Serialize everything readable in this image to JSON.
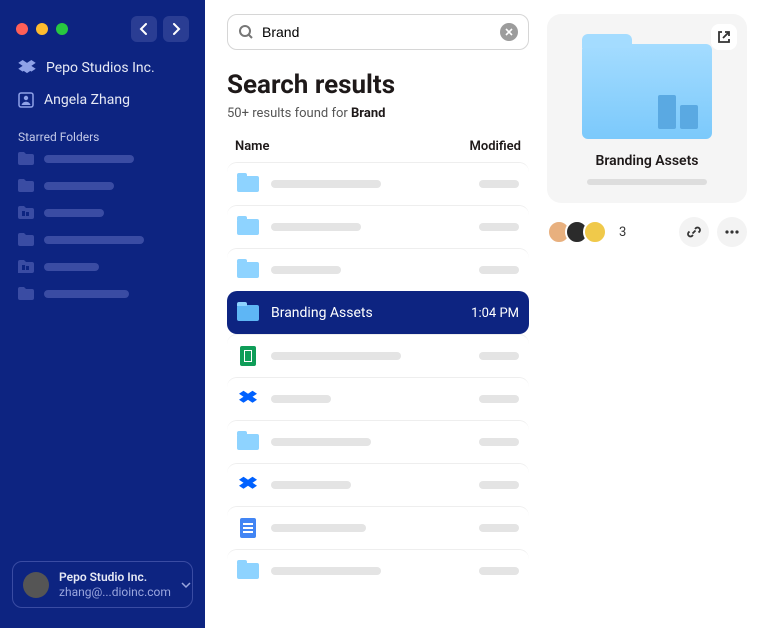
{
  "sidebar": {
    "org_name": "Pepo Studios Inc.",
    "user_name": "Angela Zhang",
    "section_title": "Starred Folders",
    "account": {
      "name": "Pepo Studio Inc.",
      "email": "zhang@...dioinc.com"
    }
  },
  "search": {
    "query": "Brand"
  },
  "results": {
    "title": "Search results",
    "count_prefix": "50+ results found for ",
    "count_term": "Brand",
    "col_name": "Name",
    "col_modified": "Modified",
    "selected": {
      "name": "Branding Assets",
      "modified": "1:04 PM"
    }
  },
  "preview": {
    "title": "Branding Assets",
    "extra_count": "3"
  }
}
